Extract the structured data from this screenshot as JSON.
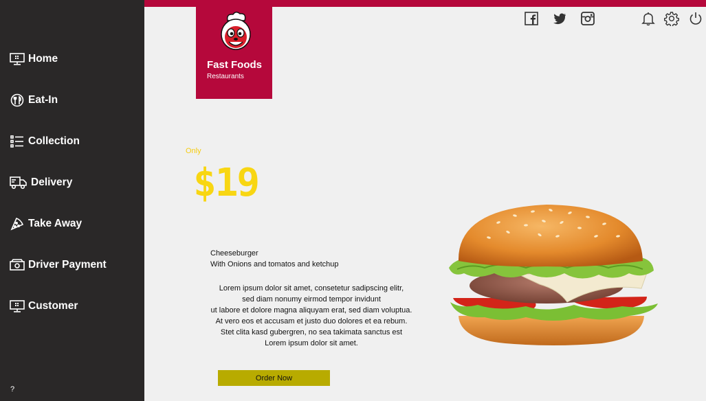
{
  "sidebar": {
    "items": [
      {
        "label": "Home",
        "icon": "monitor-icon"
      },
      {
        "label": "Eat-In",
        "icon": "cutlery-icon"
      },
      {
        "label": "Collection",
        "icon": "list-icon"
      },
      {
        "label": "Delivery",
        "icon": "truck-icon"
      },
      {
        "label": "Take Away",
        "icon": "pizza-slice-icon"
      },
      {
        "label": "Driver Payment",
        "icon": "cash-icon"
      },
      {
        "label": "Customer",
        "icon": "monitor-icon"
      }
    ],
    "help_label": "?"
  },
  "brand": {
    "title": "Fast Foods",
    "subtitle": "Restaurants",
    "color": "#b5083b"
  },
  "header": {
    "social_icons": [
      "facebook-icon",
      "twitter-icon",
      "instagram-icon"
    ],
    "action_icons": [
      "bell-icon",
      "gear-icon",
      "power-icon"
    ]
  },
  "promo": {
    "only_label": "Only",
    "price": "$19",
    "price_color": "#f8d613",
    "product_name": "Cheeseburger",
    "product_desc": "With Onions and tomatos and ketchup",
    "lorem_lines": [
      "Lorem ipsum dolor sit amet, consetetur sadipscing elitr,",
      "sed diam nonumy eirmod tempor invidunt",
      "ut labore et dolore magna aliquyam erat, sed diam voluptua.",
      "At vero eos et accusam et justo duo dolores et ea rebum.",
      "Stet clita kasd gubergren, no sea takimata sanctus est",
      "Lorem ipsum dolor sit amet."
    ],
    "order_button": "Order Now",
    "button_color": "#b8ab00"
  }
}
